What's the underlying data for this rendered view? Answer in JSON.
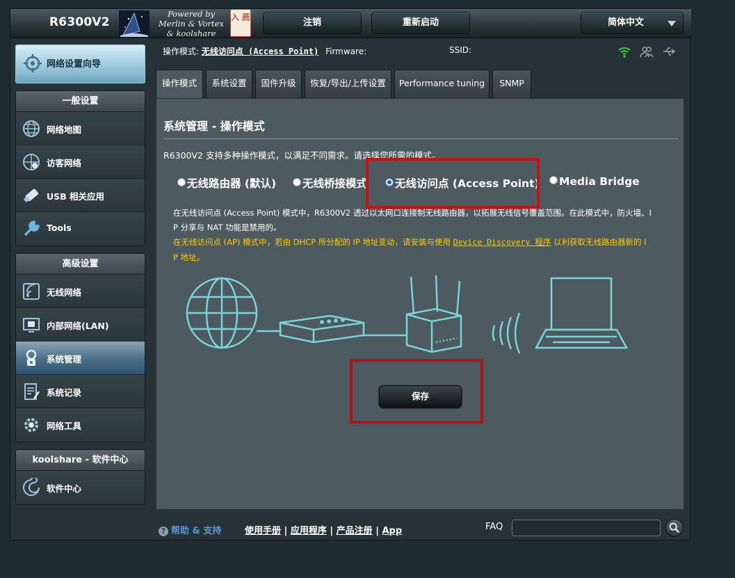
{
  "header": {
    "model": "R6300V2",
    "powered_by": [
      "Powered by",
      "Merlin & Vortex",
      "& koolshare"
    ],
    "seal_text": "入 薦",
    "logout_label": "注销",
    "reboot_label": "重新启动",
    "language": "简体中文"
  },
  "sidebar": {
    "quick_setup": "网络设置向导",
    "general_title": "一般设置",
    "general_items": [
      {
        "label": "网络地图",
        "icon": "globe-icon"
      },
      {
        "label": "访客网络",
        "icon": "guest-network-icon"
      },
      {
        "label": "USB 相关应用",
        "icon": "usb-icon"
      },
      {
        "label": "Tools",
        "icon": "wrench-icon"
      }
    ],
    "advanced_title": "高级设置",
    "advanced_items": [
      {
        "label": "无线网络",
        "icon": "wireless-icon"
      },
      {
        "label": "内部网络(LAN)",
        "icon": "lan-icon"
      },
      {
        "label": "系统管理",
        "icon": "admin-icon",
        "active": true
      },
      {
        "label": "系统记录",
        "icon": "log-icon"
      },
      {
        "label": "网络工具",
        "icon": "gear-icon"
      }
    ],
    "koolshare_title": "koolshare - 软件中心",
    "koolshare_items": [
      {
        "label": "软件中心",
        "icon": "software-center-icon"
      }
    ]
  },
  "status": {
    "op_mode_label": "操作模式:",
    "op_mode_value": "无线访问点 (Access Point)",
    "firmware_label": "Firmware:",
    "ssid_label": "SSID:"
  },
  "tabs": [
    "操作模式",
    "系统设置",
    "固件升级",
    "恢复/导出/上传设置",
    "Performance tuning",
    "SNMP"
  ],
  "panel": {
    "title": "系统管理 - 操作模式",
    "description": "R6300V2 支持多种操作模式，以满足不同需求。请选择您所需的模式。",
    "modes": [
      "无线路由器 (默认)",
      "无线桥接模式",
      "无线访问点 (Access Point)",
      "Media Bridge"
    ],
    "selected_mode": "无线访问点 (Access Point)",
    "info_line1": "在无线访问点 (Access Point) 模式中，R6300V2 透过以太网口连接制无线路由器，以拓展无线信号覆盖范围。在此模式中，防火墙、I",
    "info_line2": "P 分享与 NAT 功能是禁用的。",
    "info_warn1_prefix": "在无线访问点 (AP) 模式中，若由 DHCP 所分配的 IP 地址变动，请安装与使用",
    "info_warn1_link": "Device Discovery 程序",
    "info_warn1_suffix": "以利获取无线路由器新的 I",
    "info_warn2": "P 地址。",
    "save_label": "保存"
  },
  "footer": {
    "help": "帮助 & 支持",
    "manual": "使用手册",
    "utility": "应用程序",
    "register": "产品注册",
    "app": "App",
    "faq": "FAQ",
    "faq_placeholder": ""
  },
  "colors": {
    "highlight": "#c01416",
    "warning_text": "#ffcc00",
    "help_text": "#5a9ad6",
    "panel_bg": "#4d5a5f"
  }
}
